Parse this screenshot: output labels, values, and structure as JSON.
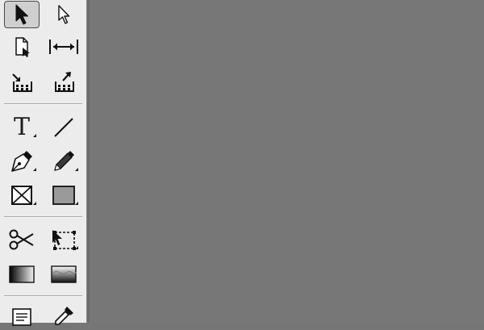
{
  "toolbox": {
    "tools": [
      {
        "name": "selection-tool",
        "selected": true
      },
      {
        "name": "direct-selection-tool",
        "selected": false
      },
      {
        "name": "page-tool",
        "selected": false
      },
      {
        "name": "gap-tool",
        "selected": false
      },
      {
        "name": "content-collector-tool",
        "selected": false
      },
      {
        "name": "content-placer-tool",
        "selected": false
      },
      {
        "name": "type-tool",
        "glyph": "T",
        "selected": false
      },
      {
        "name": "line-tool",
        "selected": false
      },
      {
        "name": "pen-tool",
        "selected": false
      },
      {
        "name": "pencil-tool",
        "selected": false
      },
      {
        "name": "rectangle-frame-tool",
        "selected": false
      },
      {
        "name": "rectangle-tool",
        "selected": false
      },
      {
        "name": "scissors-tool",
        "selected": false
      },
      {
        "name": "free-transform-tool",
        "selected": false
      },
      {
        "name": "gradient-swatch-tool",
        "selected": false
      },
      {
        "name": "gradient-feather-tool",
        "selected": false
      },
      {
        "name": "note-tool",
        "selected": false
      },
      {
        "name": "eyedropper-tool",
        "selected": false
      }
    ]
  },
  "colors": {
    "toolbox_background": "#ececec",
    "canvas_background": "#777777",
    "selected_tool_background": "#cfcfcf",
    "icon_color": "#1b1b1b"
  }
}
